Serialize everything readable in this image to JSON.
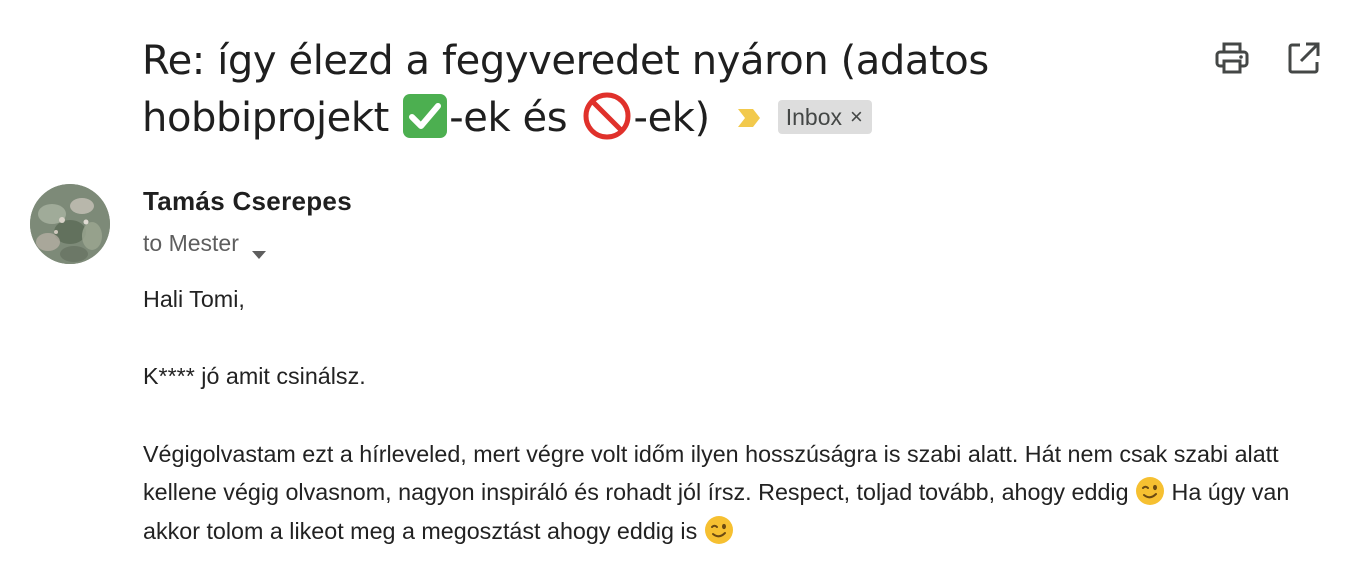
{
  "email": {
    "subject_part1": "Re: így élezd a fegyveredet nyáron (adatos hobbiprojekt ",
    "subject_part2": "-ek és ",
    "subject_part3": "-ek)",
    "label": "Inbox",
    "label_remove": "×",
    "sender": "Tamás Cserepes",
    "recipients": "to Mester",
    "body": {
      "greeting": "Hali Tomi,",
      "line1": "K**** jó amit csinálsz.",
      "para_a": "Végigolvastam ezt a hírleveled, mert végre volt időm ilyen hosszúságra is  szabi alatt. Hát nem csak szabi alatt kellene végig olvasnom, nagyon inspiráló és rohadt jól írsz. Respect, toljad tovább, ahogy eddig ",
      "para_b": " Ha úgy van akkor tolom a likeot meg a megosztást ahogy eddig is "
    }
  },
  "icons": {
    "check": "check-mark-button-emoji",
    "no_entry": "prohibited-emoji",
    "importance": "importance-marker-icon",
    "print": "print-icon",
    "open_new_window": "open-in-new-window-icon",
    "caret": "caret-down-icon",
    "wink": "winking-face-emoji"
  },
  "colors": {
    "importance": "#f2c94c",
    "chip_bg": "#dddddd",
    "check_green": "#4caf50",
    "prohibited_red": "#e0312b",
    "wink_yellow": "#f6c031"
  }
}
